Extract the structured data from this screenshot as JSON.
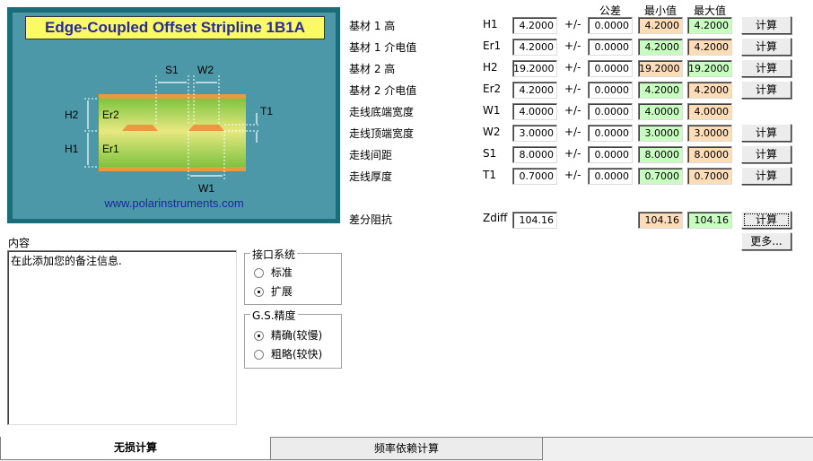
{
  "diagram": {
    "title": "Edge-Coupled Offset Stripline 1B1A",
    "website": "www.polarinstruments.com",
    "labels": {
      "s1": "S1",
      "w2": "W2",
      "t1": "T1",
      "h2": "H2",
      "h1": "H1",
      "er2": "Er2",
      "er1": "Er1",
      "w1": "W1"
    }
  },
  "headers": {
    "tolerance": "公差",
    "min": "最小值",
    "max": "最大值"
  },
  "params": [
    {
      "label": "基材 1 高",
      "sym": "H1",
      "value": "4.2000",
      "tol": "0.0000",
      "min": "4.2000",
      "max": "4.2000",
      "min_color": "orange",
      "max_color": "green",
      "button": "计算"
    },
    {
      "label": "基材 1 介电值",
      "sym": "Er1",
      "value": "4.2000",
      "tol": "0.0000",
      "min": "4.2000",
      "max": "4.2000",
      "min_color": "green",
      "max_color": "orange",
      "button": "计算"
    },
    {
      "label": "基材 2 高",
      "sym": "H2",
      "value": "19.2000",
      "tol": "0.0000",
      "min": "19.2000",
      "max": "19.2000",
      "min_color": "orange",
      "max_color": "green",
      "button": "计算"
    },
    {
      "label": "基材 2 介电值",
      "sym": "Er2",
      "value": "4.2000",
      "tol": "0.0000",
      "min": "4.2000",
      "max": "4.2000",
      "min_color": "green",
      "max_color": "orange",
      "button": "计算"
    },
    {
      "label": "走线底端宽度",
      "sym": "W1",
      "value": "4.0000",
      "tol": "0.0000",
      "min": "4.0000",
      "max": "4.0000",
      "min_color": "green",
      "max_color": "orange",
      "button": ""
    },
    {
      "label": "走线顶端宽度",
      "sym": "W2",
      "value": "3.0000",
      "tol": "0.0000",
      "min": "3.0000",
      "max": "3.0000",
      "min_color": "green",
      "max_color": "orange",
      "button": "计算"
    },
    {
      "label": "走线间距",
      "sym": "S1",
      "value": "8.0000",
      "tol": "0.0000",
      "min": "8.0000",
      "max": "8.0000",
      "min_color": "green",
      "max_color": "orange",
      "button": "计算"
    },
    {
      "label": "走线厚度",
      "sym": "T1",
      "value": "0.7000",
      "tol": "0.0000",
      "min": "0.7000",
      "max": "0.7000",
      "min_color": "green",
      "max_color": "orange",
      "button": "计算"
    }
  ],
  "pm_sign": "+/-",
  "impedance": {
    "label": "差分阻抗",
    "sym": "Zdiff",
    "value": "104.16",
    "min": "104.16",
    "max": "104.16",
    "button": "计算",
    "more_button": "更多..."
  },
  "notes": {
    "label": "内容",
    "text": "在此添加您的备注信息."
  },
  "interface_group": {
    "title": "接口系统",
    "options": [
      "标准",
      "扩展"
    ],
    "selected": 1
  },
  "precision_group": {
    "title": "G.S.精度",
    "options": [
      "精确(较慢)",
      "粗略(较快)"
    ],
    "selected": 0
  },
  "tabs": [
    "无损计算",
    "频率依赖计算"
  ],
  "active_tab": 0
}
